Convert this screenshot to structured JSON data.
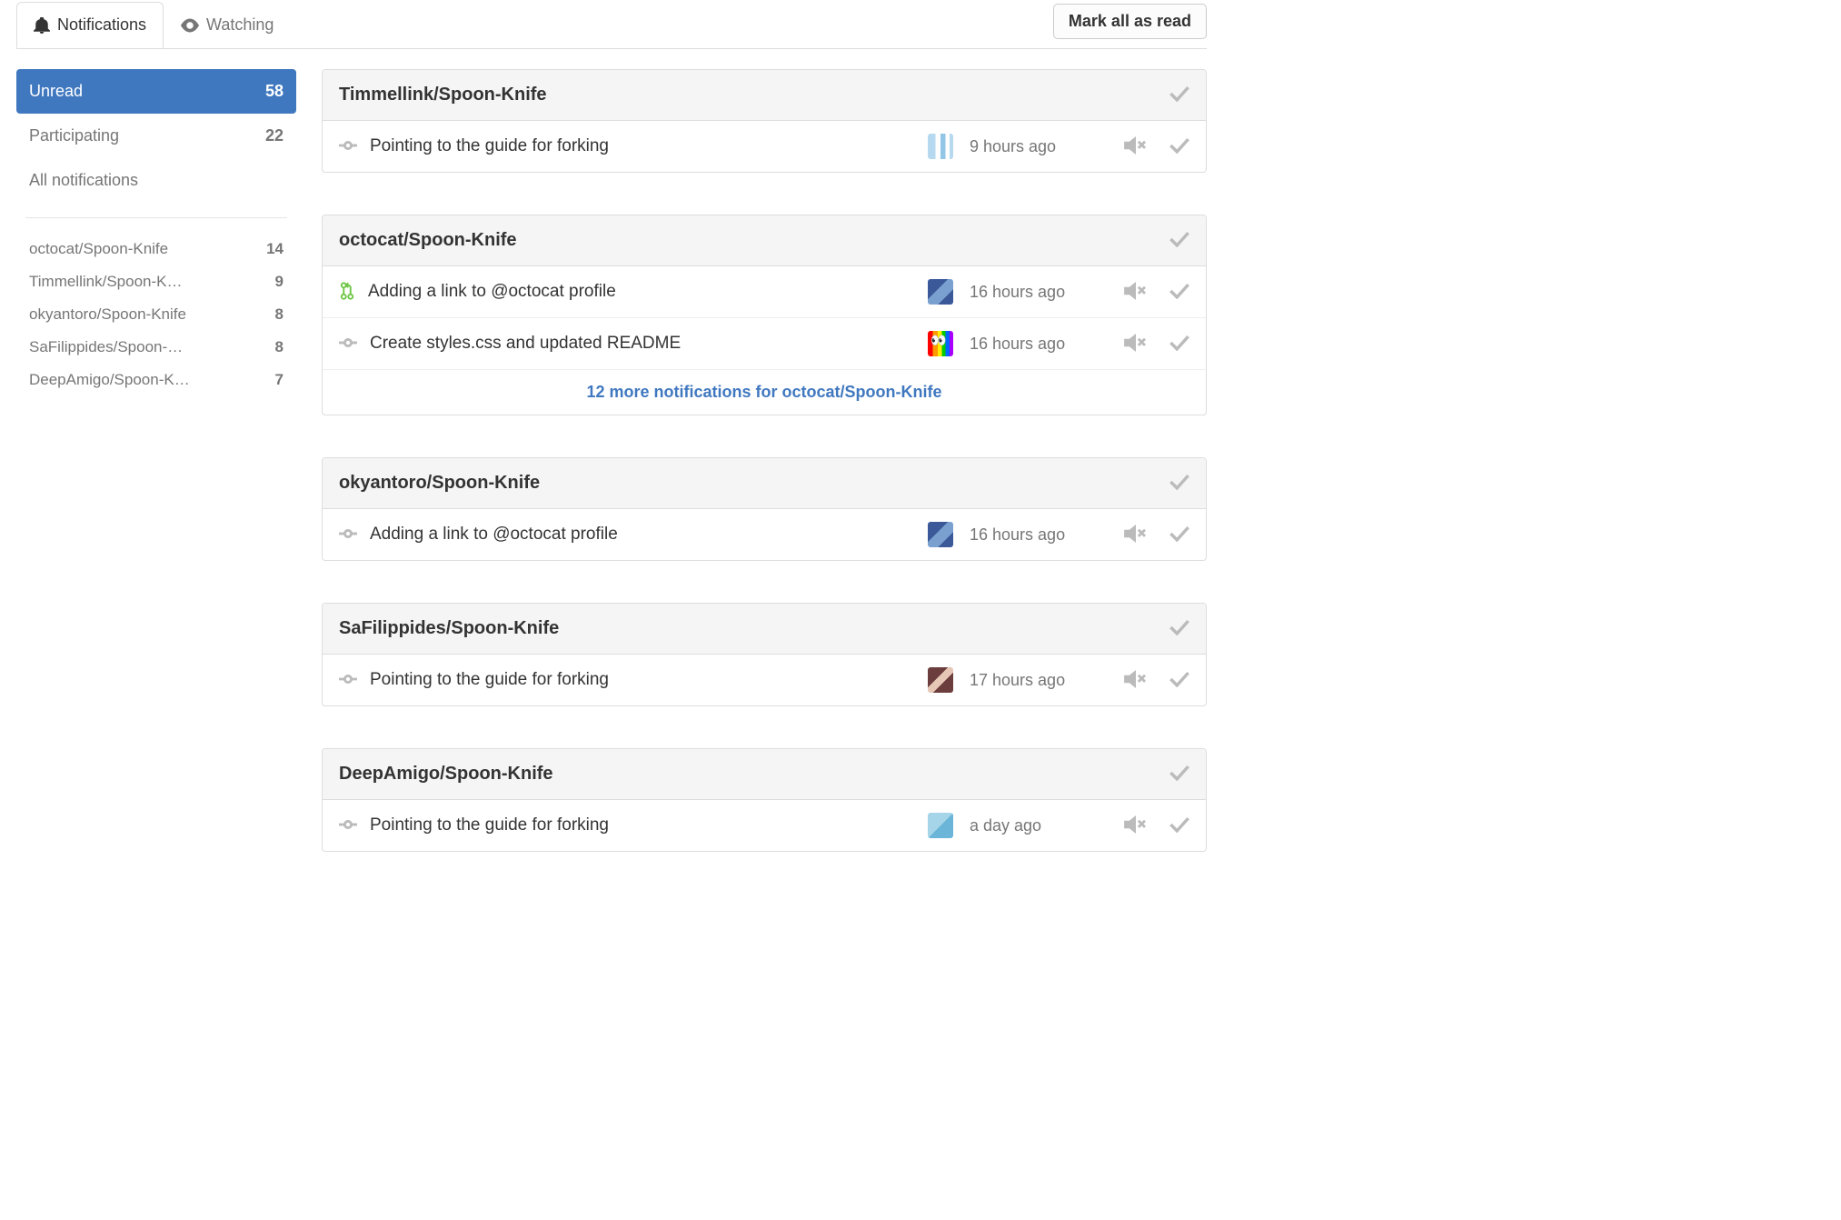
{
  "tabs": {
    "notifications": "Notifications",
    "watching": "Watching"
  },
  "mark_all_label": "Mark all as read",
  "filters": {
    "unread": {
      "label": "Unread",
      "count": "58"
    },
    "participating": {
      "label": "Participating",
      "count": "22"
    },
    "all": {
      "label": "All notifications"
    }
  },
  "repo_filters": [
    {
      "name": "octocat/Spoon-Knife",
      "count": "14"
    },
    {
      "name": "Timmellink/Spoon-K…",
      "count": "9"
    },
    {
      "name": "okyantoro/Spoon-Knife",
      "count": "8"
    },
    {
      "name": "SaFilippides/Spoon-…",
      "count": "8"
    },
    {
      "name": "DeepAmigo/Spoon-K…",
      "count": "7"
    }
  ],
  "groups": [
    {
      "title": "Timmellink/Spoon-Knife",
      "items": [
        {
          "icon": "commit",
          "subject": "Pointing to the guide for forking",
          "avatar": "av1",
          "time": "9 hours ago"
        }
      ]
    },
    {
      "title": "octocat/Spoon-Knife",
      "items": [
        {
          "icon": "pr",
          "subject": "Adding a link to @octocat profile",
          "avatar": "av2",
          "time": "16 hours ago"
        },
        {
          "icon": "commit",
          "subject": "Create styles.css and updated README",
          "avatar": "av3",
          "time": "16 hours ago"
        }
      ],
      "more": "12 more notifications for octocat/Spoon-Knife"
    },
    {
      "title": "okyantoro/Spoon-Knife",
      "items": [
        {
          "icon": "commit",
          "subject": "Adding a link to @octocat profile",
          "avatar": "av2",
          "time": "16 hours ago"
        }
      ]
    },
    {
      "title": "SaFilippides/Spoon-Knife",
      "items": [
        {
          "icon": "commit",
          "subject": "Pointing to the guide for forking",
          "avatar": "av4",
          "time": "17 hours ago"
        }
      ]
    },
    {
      "title": "DeepAmigo/Spoon-Knife",
      "items": [
        {
          "icon": "commit",
          "subject": "Pointing to the guide for forking",
          "avatar": "av5",
          "time": "a day ago"
        }
      ]
    }
  ]
}
